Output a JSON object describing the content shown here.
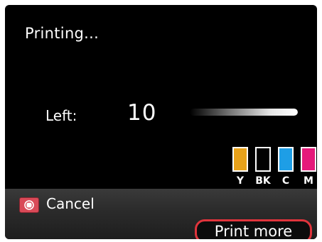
{
  "status": {
    "title": "Printing..."
  },
  "job": {
    "left_label": "Left:",
    "left_count": "10",
    "progress_fraction": 1.0
  },
  "ink": {
    "cartridges": [
      {
        "label": "Y",
        "color": "#e8a21a",
        "level": 1.0
      },
      {
        "label": "BK",
        "color": "#000000",
        "level": 0.0
      },
      {
        "label": "C",
        "color": "#1e9ee6",
        "level": 1.0
      },
      {
        "label": "M",
        "color": "#e5197a",
        "level": 1.0
      }
    ]
  },
  "bottom": {
    "cancel_icon": "stop-icon",
    "cancel_label": "Cancel",
    "print_more_label": "Print more",
    "highlight_color": "#e0343c"
  }
}
